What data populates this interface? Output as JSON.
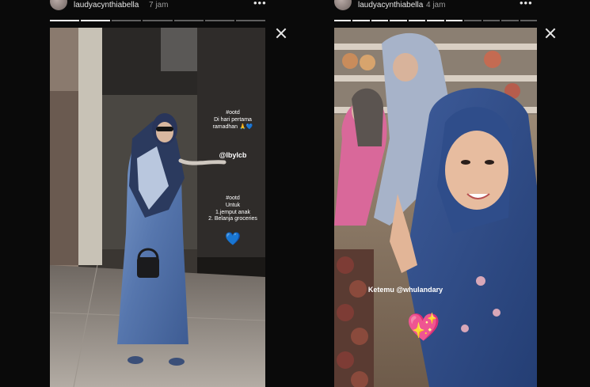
{
  "left_story": {
    "username": "laudyacynthiabella",
    "time": "7 jam",
    "more_label": "•••",
    "progress_segments": 7,
    "progress_done": 2,
    "ootd_1": {
      "tag": "#ootd",
      "line1": "Di hari pertama",
      "line2": "ramadhan 🙏💙"
    },
    "mention": "@lbylcb",
    "ootd_2": {
      "tag": "#ootd",
      "line1": "Untuk",
      "line2": "1.jemput anak",
      "line3": "2. Belanja groceries"
    },
    "heart_emoji": "💙"
  },
  "right_story": {
    "username": "laudyacynthiabella",
    "time": "4 jam",
    "more_label": "•••",
    "progress_segments": 11,
    "progress_done": 7,
    "caption": "Ketemu @whulandary",
    "heart_sticker": "💖"
  }
}
